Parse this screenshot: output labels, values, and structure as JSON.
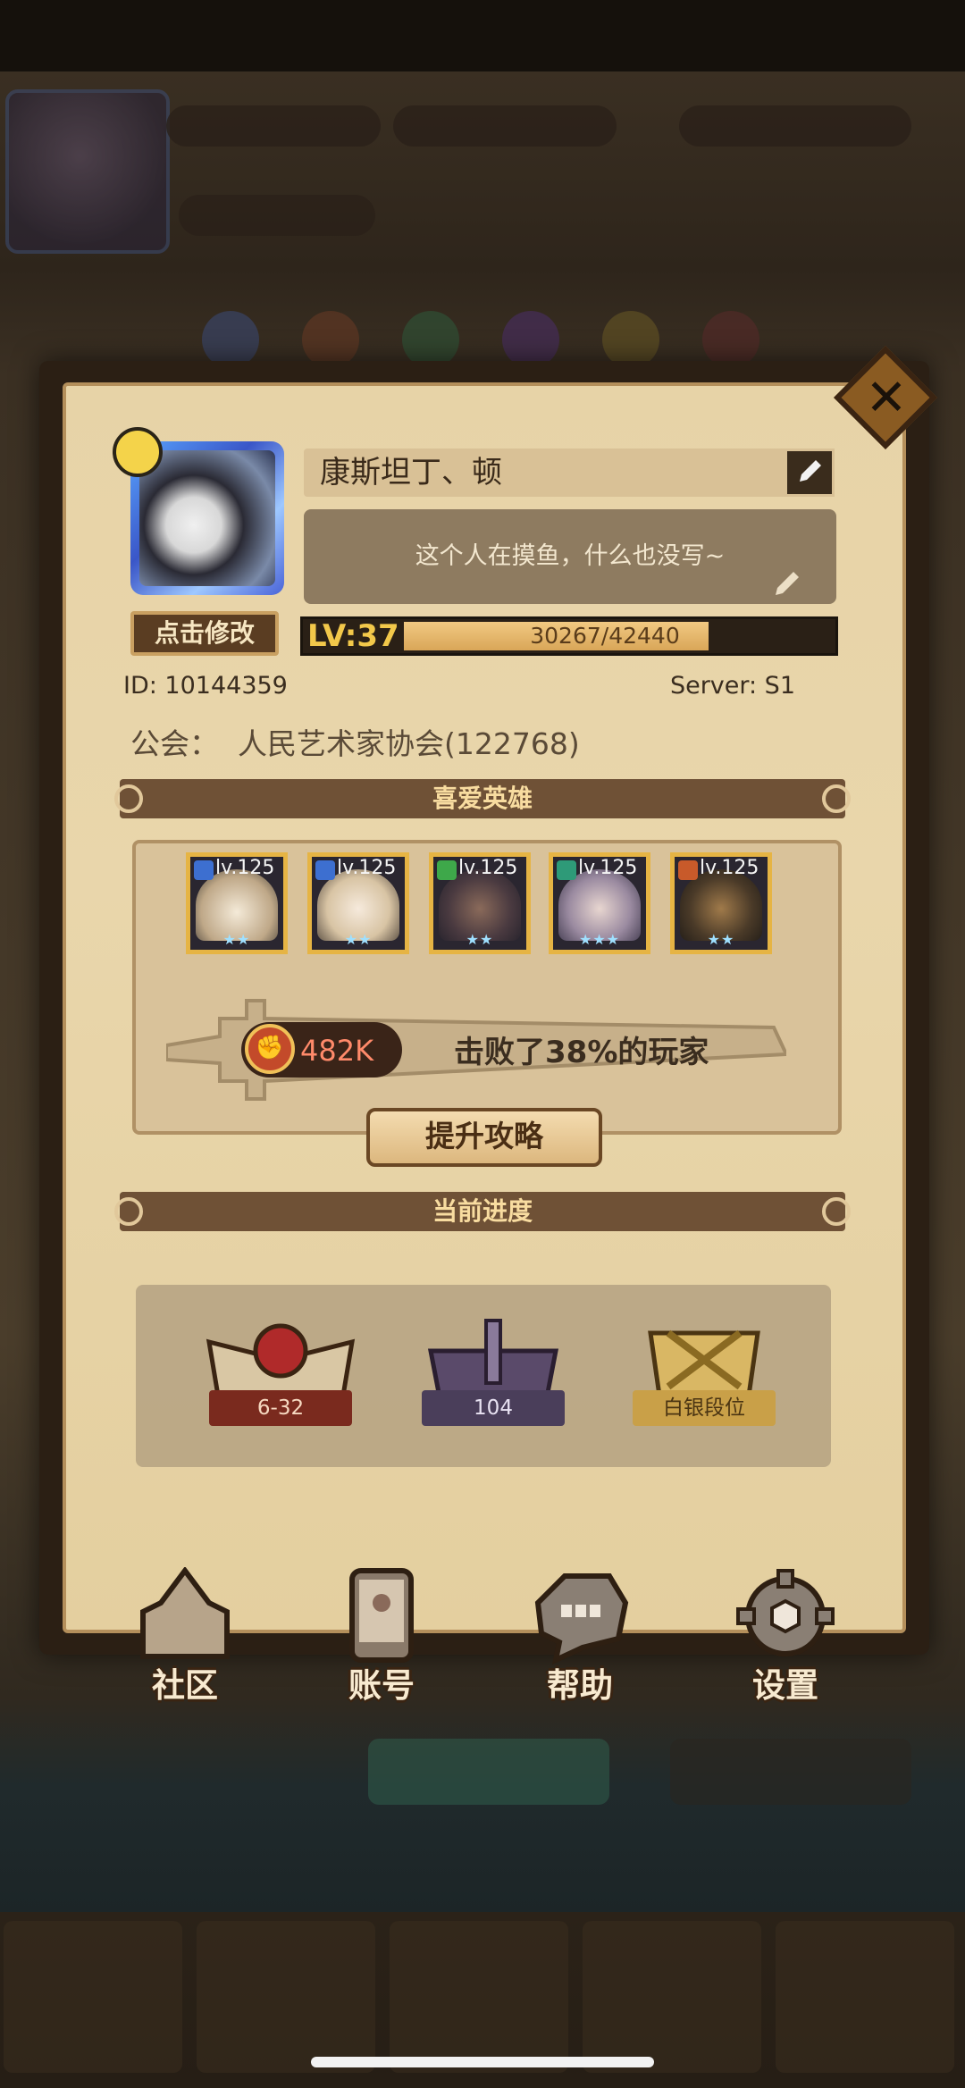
{
  "profile": {
    "name": "康斯坦丁、顿",
    "signature": "这个人在摸鱼，什么也没写~",
    "edit_avatar_label": "点击修改",
    "level_label": "LV:37",
    "exp_text": "30267/42440",
    "exp_progress": 0.713,
    "id_text": "ID:  10144359",
    "server_text": "Server: S1",
    "guild_label": "公会：",
    "guild_value": "人民艺术家协会(122768)"
  },
  "favorite_heroes": {
    "title": "喜爱英雄",
    "heroes": [
      {
        "level": "lv.125",
        "class_color": "#3d6fd0",
        "stars": "★★"
      },
      {
        "level": "lv.125",
        "class_color": "#3d6fd0",
        "stars": "★★"
      },
      {
        "level": "lv.125",
        "class_color": "#3ea84a",
        "stars": "★★"
      },
      {
        "level": "lv.125",
        "class_color": "#2e9a78",
        "stars": "★★★"
      },
      {
        "level": "lv.125",
        "class_color": "#c85a2a",
        "stars": "★★"
      }
    ],
    "power_value": "482K",
    "defeat_text": "击败了38%的玩家",
    "guide_button": "提升攻略"
  },
  "current_progress": {
    "title": "当前进度",
    "items": [
      {
        "label": "6-32",
        "icon": "campaign-book-icon"
      },
      {
        "label": "104",
        "icon": "tower-icon"
      },
      {
        "label": "白银段位",
        "icon": "arena-rank-icon"
      }
    ]
  },
  "bottom_nav": [
    {
      "label": "社区",
      "icon": "castle-icon"
    },
    {
      "label": "账号",
      "icon": "account-card-icon"
    },
    {
      "label": "帮助",
      "icon": "chat-bubble-icon"
    },
    {
      "label": "设置",
      "icon": "gear-icon"
    }
  ],
  "colors": {
    "panel": "#e7d3a7",
    "banner": "#6f5136",
    "accent_gold": "#f2c84a",
    "power_red": "#ff8a6a"
  }
}
